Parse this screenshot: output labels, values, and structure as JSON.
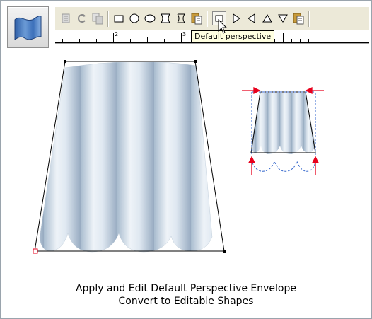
{
  "toolbar": {
    "buttons": [
      {
        "name": "copy-envelope-icon"
      },
      {
        "name": "rotate-icon"
      },
      {
        "name": "duplicate-icon"
      },
      {
        "name": "rectangle-envelope-icon"
      },
      {
        "name": "circle-envelope-icon"
      },
      {
        "name": "ellipse-envelope-icon"
      },
      {
        "name": "hourglass-envelope-icon"
      },
      {
        "name": "bow-envelope-icon"
      },
      {
        "name": "paste-envelope-icon"
      },
      {
        "name": "default-perspective-icon",
        "pressed": true
      },
      {
        "name": "perspective-right-icon"
      },
      {
        "name": "perspective-left-icon"
      },
      {
        "name": "perspective-up-icon"
      },
      {
        "name": "perspective-down-icon"
      },
      {
        "name": "paste-perspective-icon"
      }
    ]
  },
  "ruler": {
    "labels": [
      "2",
      "3"
    ]
  },
  "tooltip": {
    "text": "Default perspective"
  },
  "caption": {
    "line1": "Apply and Edit Default Perspective Envelope",
    "line2": "Convert to Editable Shapes"
  },
  "colors": {
    "accent_red": "#e8001c",
    "guide_blue": "#3366cc",
    "fabric_light": "#e6eef6",
    "fabric_dark": "#9fb1c5"
  }
}
